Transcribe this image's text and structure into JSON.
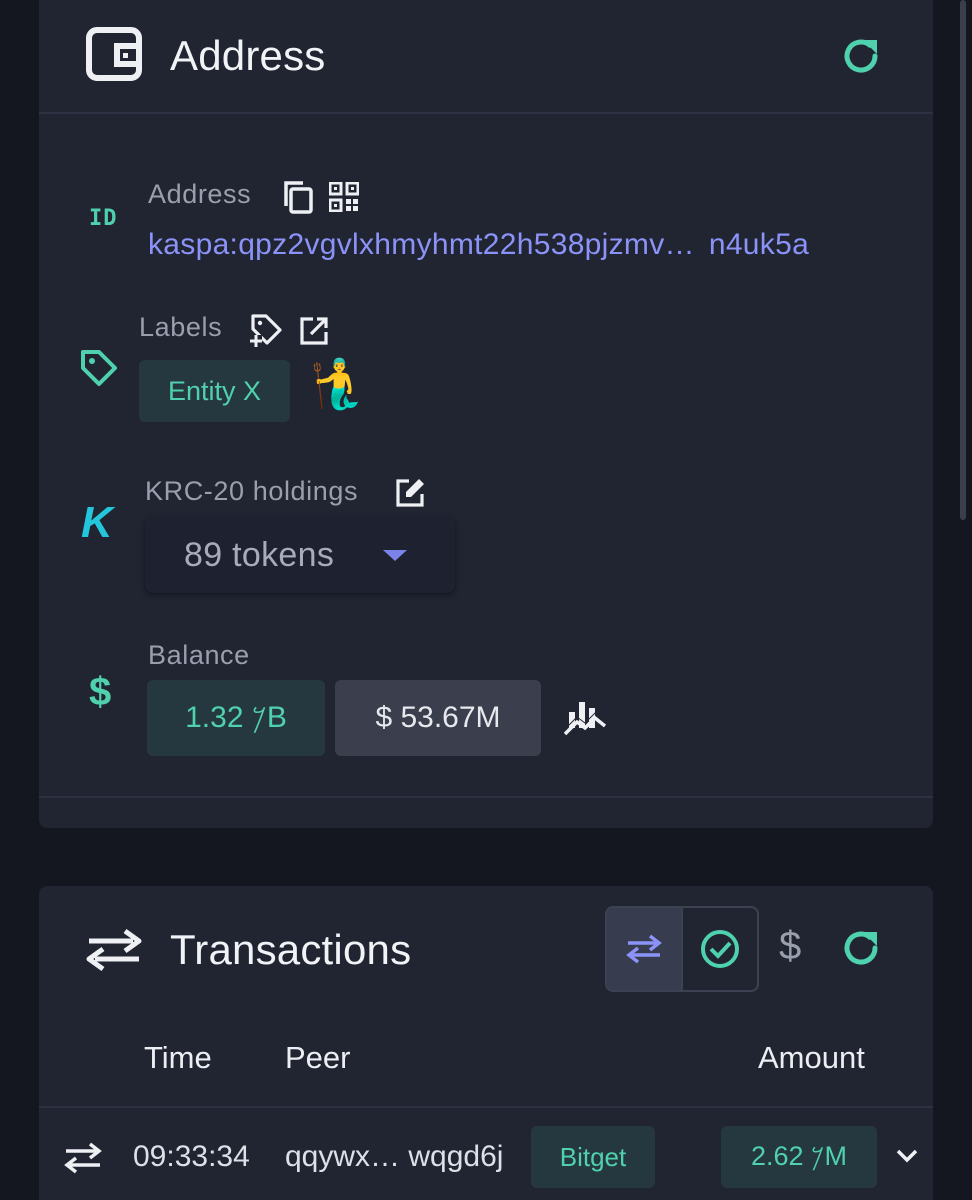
{
  "address_card": {
    "title": "Address",
    "address": {
      "label": "Address",
      "value_start": "kaspa:qpz2vgvlxhmyhmt22h538pjzmv…",
      "value_end": "n4uk5a"
    },
    "id_badge": "ID",
    "labels": {
      "label": "Labels",
      "tags": [
        "Entity X"
      ],
      "emoji": "🧜‍♂️"
    },
    "krc20": {
      "label": "KRC-20 holdings",
      "selected": "89 tokens",
      "logo": "K"
    },
    "balance": {
      "label": "Balance",
      "kas_value": "𐤊 1.32B",
      "usd_value": "$ 53.67M",
      "currency_glyph": "$"
    }
  },
  "transactions_card": {
    "title": "Transactions",
    "usd_toggle": "$",
    "columns": [
      "Time",
      "Peer",
      "Amount"
    ],
    "rows": [
      {
        "time": "09:33:34",
        "peer": "qqywx… wqgd6j",
        "peer_label": "Bitget",
        "amount": "𐤊 2.62M"
      }
    ]
  },
  "colors": {
    "background": "#141720",
    "card": "#212532",
    "accent_teal": "#4fd1ae",
    "accent_indigo": "#8b93f8",
    "chip_teal_bg": "#26383f"
  },
  "icons": [
    "wallet-icon",
    "refresh-icon",
    "copy-icon",
    "qr-code-icon",
    "tag-icon",
    "add-tag-icon",
    "external-link-icon",
    "edit-icon",
    "dollar-icon",
    "chart-icon",
    "transfer-icon",
    "check-circle-icon",
    "chevron-down-icon"
  ]
}
